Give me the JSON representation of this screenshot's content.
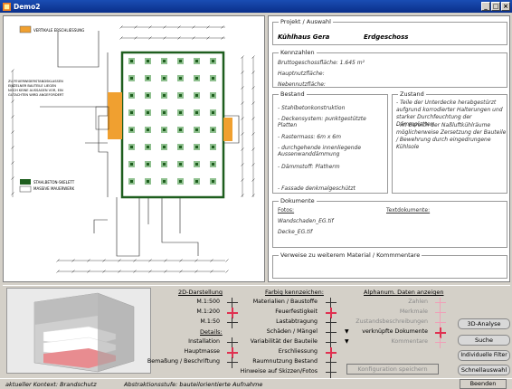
{
  "window": {
    "title": "Demo2"
  },
  "plan": {
    "legend_top": "VERTIKALE ERSCHLIESSUNG",
    "note_lines": [
      "ZU FEUERWIDERSTANDSKLASSEN",
      "EINZELNER BAUTEILE LIEGEN",
      "NOCH KEINE AUSSAGEN VOR, EIN",
      "GUTACHTEN WIRD ANGEFORDERT"
    ],
    "legend_bottom_1": "STAHLBETON-SKELETT",
    "legend_bottom_2": "MASSIVE MAUERWERK",
    "colors": {
      "structure": "#1e5e1e",
      "vertical": "#f0a030",
      "grid": "#8fc08f"
    }
  },
  "info": {
    "project_legend": "Projekt / Auswahl",
    "project_name": "Kühlhaus Gera",
    "floor": "Erdgeschoss",
    "kennzahlen_legend": "Kennzahlen",
    "brutto": "Bruttogeschossfläche: 1.645 m²",
    "haupt": "Hauptnutzfläche:",
    "neben": "Nebennutzfläche:",
    "bestand_legend": "Bestand",
    "bestand_items": [
      "- Stahlbetonkonstruktion",
      "- Deckensystem: punktgestützte Platten",
      "- Rastermass: 6m x 6m",
      "- durchgehende innenliegende Aussenwanddämmung",
      "- Dämmstoff: Platherm",
      "- Fassade denkmalgeschützt"
    ],
    "zustand_legend": "Zustand",
    "zustand_items": [
      "- Teile der Unterdecke herabgestürzt aufgrund korrodierter Halterungen und starker Durchfeuchtung der Dämmplatten",
      "- im Bereich der Naßluftkühlräume möglicherweise Zersetzung der Bauteile / Bewehrung durch eingedrungene Kühlsole"
    ],
    "dokumente_legend": "Dokumente",
    "fotos_label": "Fotos:",
    "fotos": [
      "Wandschaden_EG.tif",
      "Decke_EG.tif"
    ],
    "text_label": "Textdokumente:",
    "verweise_legend": "Verweise zu weiterem Material / Kommmentare"
  },
  "controls": {
    "darstellung_header": "2D-Darstellung",
    "darstellung_rows": [
      "M.1:500",
      "M.1:200",
      "M.1:50"
    ],
    "details_header": "Details:",
    "details_rows": [
      "Installation",
      "Hauptmasse",
      "Bemaßung / Beschriftung"
    ],
    "farbig_header": "Farbig kennzeichen:",
    "farbig_rows": [
      "Materialien / Baustoffe",
      "Feuerfestigkeit",
      "Lastabtragung",
      "Schäden / Mängel",
      "Variabilität der Bauteile",
      "Erschliessung",
      "Raumnutzung Bestand",
      "Hinweise auf Skizzen/Fotos"
    ],
    "alphanum_header": "Alphanum. Daten anzeigen",
    "alphanum_rows": [
      "Zahlen",
      "Merkmale",
      "Zustandsbeschreibungen",
      "verknüpfte Dokumente",
      "Kommentare"
    ],
    "save_config": "Konfiguration speichern",
    "buttons": [
      "3D-Analyse",
      "Suche",
      "Individuelle Filter",
      "Schnellauswahl"
    ]
  },
  "status": {
    "context": "aktueller Kontext: Brandschutz",
    "level": "Abstraktionsstufe: bauteilorientierte Aufnahme",
    "quit": "Beenden"
  }
}
